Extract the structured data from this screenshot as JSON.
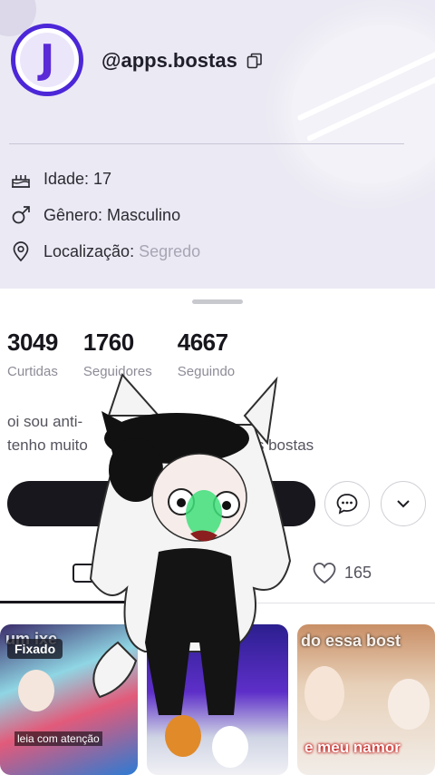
{
  "profile": {
    "avatar_letter": "J",
    "username": "@apps.bostas",
    "info": [
      {
        "icon": "cake-icon",
        "label": "Idade: 17"
      },
      {
        "icon": "male-icon",
        "label": "Gênero: Masculino"
      },
      {
        "icon": "location-icon",
        "label": "Localização: ",
        "value": "Segredo"
      }
    ]
  },
  "stats": [
    {
      "value": "3049",
      "label": "Curtidas"
    },
    {
      "value": "1760",
      "label": "Seguidores"
    },
    {
      "value": "4667",
      "label": "Seguindo"
    }
  ],
  "bio": {
    "line1": "oi sou anti-",
    "line2": "tenho muito",
    "line2_end": "s bostas"
  },
  "tabs": {
    "likes_count": "165"
  },
  "videos": [
    {
      "badge": "Fixado",
      "caption": "um ixe",
      "subcaption": "leia com atenção"
    },
    {
      "caption": ""
    },
    {
      "caption": "do essa bost",
      "subcaption": "e meu namor"
    }
  ],
  "colors": {
    "accent": "#4c27d8",
    "header_bg": "#ebe9f3",
    "button_dark": "#17171d"
  }
}
